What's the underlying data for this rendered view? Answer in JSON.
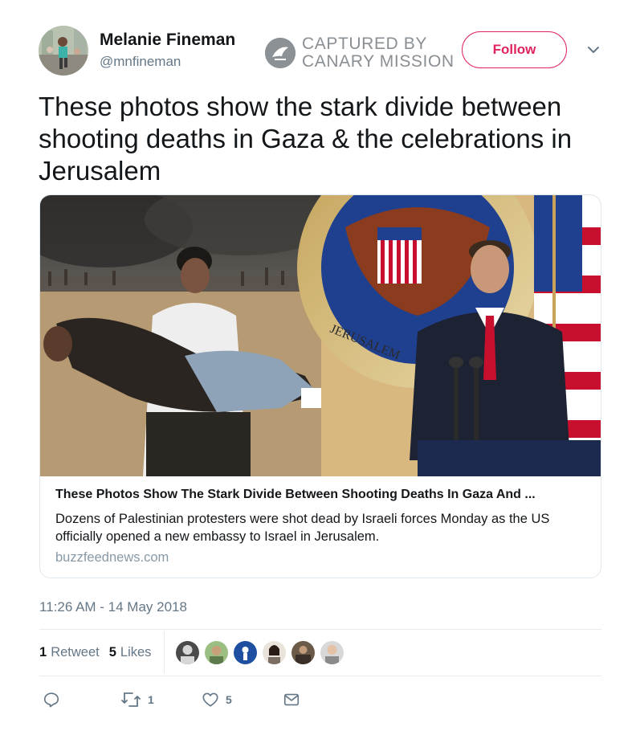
{
  "user": {
    "display_name": "Melanie Fineman",
    "handle": "@mnfineman"
  },
  "watermark": {
    "line1": "CAPTURED BY",
    "line2": "CANARY MISSION"
  },
  "follow_label": "Follow",
  "tweet_text": "These photos show the stark divide between shooting deaths in Gaza & the celebrations in Jerusalem",
  "card": {
    "title": "These Photos Show The Stark Divide Between Shooting Deaths In Gaza And ...",
    "description": "Dozens of Palestinian protesters were shot dead by Israeli forces Monday as the US officially opened a new embassy to Israel in Jerusalem.",
    "domain": "buzzfeednews.com",
    "image_seal_text": "JERUSALEM"
  },
  "timestamp": "11:26 AM - 14 May 2018",
  "stats": {
    "retweets_count": "1",
    "retweets_label": "Retweet",
    "likes_count": "5",
    "likes_label": "Likes"
  },
  "actions": {
    "reply_count": "",
    "retweet_count": "1",
    "like_count": "5"
  },
  "colors": {
    "accent": "#e0245e",
    "secondary_text": "#657786",
    "link_domain": "#8899a6"
  },
  "icons": [
    "reply-icon",
    "retweet-icon",
    "heart-icon",
    "envelope-icon",
    "chevron-down-icon"
  ]
}
